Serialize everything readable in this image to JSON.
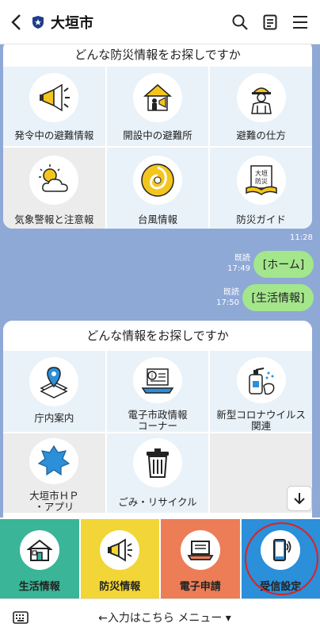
{
  "header": {
    "title": "大垣市"
  },
  "disaster_card": {
    "title": "どんな防災情報をお探しですか",
    "items": [
      {
        "label": "発令中の避難情報",
        "icon": "megaphone-icon"
      },
      {
        "label": "開設中の避難所",
        "icon": "shelter-icon"
      },
      {
        "label": "避難の仕方",
        "icon": "evacuation-worker-icon"
      },
      {
        "label": "気象警報と注意報",
        "icon": "weather-icon"
      },
      {
        "label": "台風情報",
        "icon": "typhoon-icon"
      },
      {
        "label": "防災ガイド",
        "icon": "disaster-guide-book-icon"
      }
    ]
  },
  "messages": {
    "time1": "11:28",
    "msg1": {
      "read": "既読",
      "time": "17:49",
      "text": "[ホーム]"
    },
    "msg2": {
      "read": "既読",
      "time": "17:50",
      "text": "[生活情報]"
    }
  },
  "info_card": {
    "title": "どんな情報をお探しですか",
    "items": [
      {
        "label": "庁内案内",
        "icon": "map-pin-icon"
      },
      {
        "label": "電子市政情報\nコーナー",
        "icon": "laptop-info-icon"
      },
      {
        "label": "新型コロナウイルス\n関連",
        "icon": "sanitizer-icon"
      },
      {
        "label": "大垣市ＨＰ\n・アプリ",
        "icon": "puzzle-city-icon"
      },
      {
        "label": "ごみ・リサイクル",
        "icon": "trash-can-icon"
      }
    ]
  },
  "menu": {
    "items": [
      {
        "label": "生活情報",
        "bg": "#3ab597",
        "icon": "house-icon"
      },
      {
        "label": "防災情報",
        "bg": "#f2d536",
        "icon": "megaphone-icon"
      },
      {
        "label": "電子申請",
        "bg": "#ec7d57",
        "icon": "laptop-icon"
      },
      {
        "label": "受信設定",
        "bg": "#2b8fd9",
        "icon": "smartphone-icon"
      }
    ]
  },
  "bottom_bar": {
    "label": "←入力はこちら メニュー ▾"
  }
}
